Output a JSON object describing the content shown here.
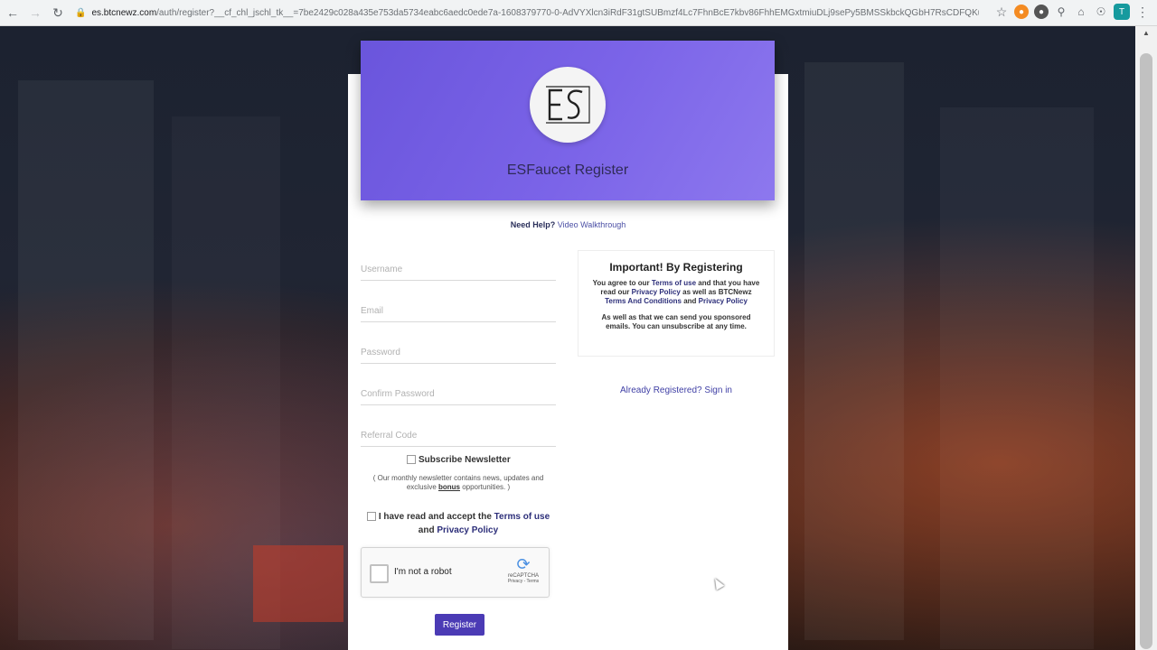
{
  "browser": {
    "url_host": "es.btcnewz.com",
    "url_path": "/auth/register?__cf_chl_jschl_tk__=7be2429c028a435e753da5734eabc6aedc0ede7a-1608379770-0-AdVYXlcn3iRdF31gtSUBmzf4Lc7FhnBcE7kbv86FhhEMGxtmiuDLj9sePy5BMSSkbckQGbH7RsCDFQKuTNQDR0bd4...",
    "profile_initial": "T"
  },
  "hero": {
    "title": "ESFaucet Register"
  },
  "help": {
    "prefix": "Need Help?",
    "link": "Video Walkthrough"
  },
  "form": {
    "username_placeholder": "Username",
    "email_placeholder": "Email",
    "password_placeholder": "Password",
    "confirm_placeholder": "Confirm Password",
    "referral_placeholder": "Referral Code",
    "newsletter_label": "Subscribe Newsletter",
    "newsletter_note_pre": "( Our monthly newsletter contains news, updates and exclusive ",
    "newsletter_note_bold": "bonus",
    "newsletter_note_post": " opportunities. )",
    "terms_pre": "I have read and accept the ",
    "terms_link": "Terms of use",
    "terms_and": " and ",
    "privacy_link": "Privacy Policy",
    "captcha_text": "I'm not a robot",
    "captcha_brand": "reCAPTCHA",
    "captcha_sub": "Privacy - Terms",
    "register_label": "Register"
  },
  "info": {
    "heading": "Important! By Registering",
    "p1_a": "You agree to our ",
    "p1_terms": "Terms of use",
    "p1_b": " and that you have read our ",
    "p1_privacy": "Privacy Policy",
    "p1_c": " as well as BTCNewz ",
    "p1_tac": "Terms And Conditions",
    "p1_d": " and ",
    "p1_privacy2": "Privacy Policy",
    "p2": "As well as that we can send you sponsored emails. You can unsubscribe at any time."
  },
  "signin": {
    "label": "Already Registered? Sign in"
  }
}
